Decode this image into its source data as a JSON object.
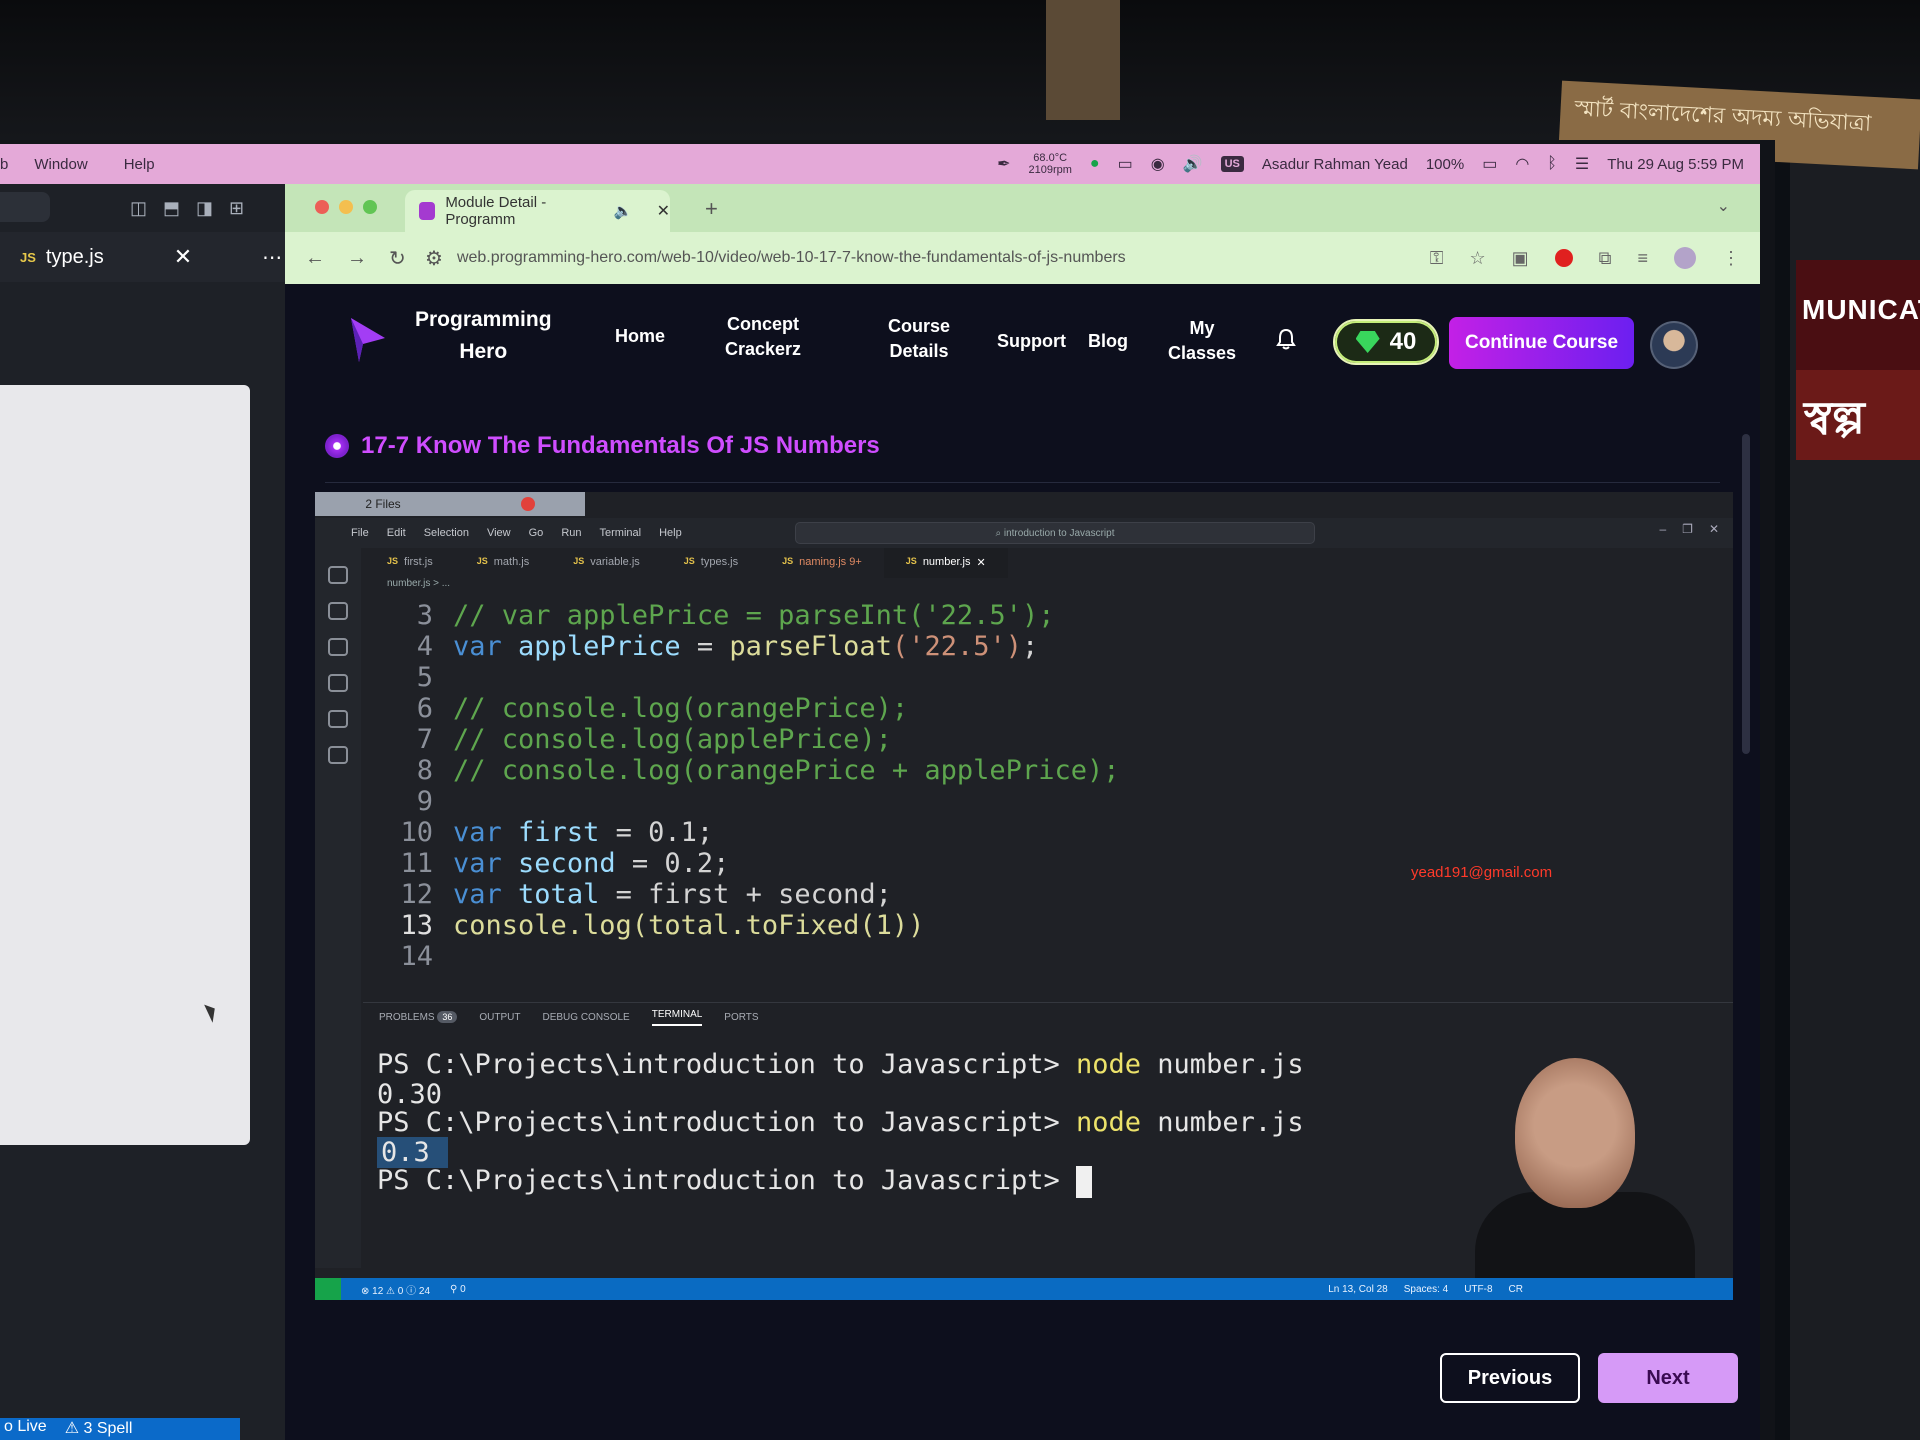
{
  "mac_menubar": {
    "items": [
      "b",
      "Window",
      "Help"
    ],
    "cpu_temp": "68.0°C",
    "fan_speed": "2109rpm",
    "input_source": "US",
    "user_name": "Asadur Rahman Yead",
    "battery": "100%",
    "datetime": "Thu 29 Aug  5:59 PM"
  },
  "left_editor": {
    "tab_label": "type.js",
    "tab_lang": "JS",
    "status_items": [
      "o Live",
      "⚠ 3 Spell"
    ]
  },
  "browser": {
    "tab_title": "Module Detail - Programm",
    "url": "web.programming-hero.com/web-10/video/web-10-17-7-know-the-fundamentals-of-js-numbers"
  },
  "site": {
    "brand_line1": "Programming",
    "brand_line2": "Hero",
    "nav": {
      "home": "Home",
      "concept_l1": "Concept",
      "concept_l2": "Crackerz",
      "course_l1": "Course",
      "course_l2": "Details",
      "support": "Support",
      "blog": "Blog",
      "classes_l1": "My",
      "classes_l2": "Classes"
    },
    "gems": "40",
    "continue_button": "Continue Course",
    "lesson_title": "17-7 Know The Fundamentals Of JS Numbers",
    "prev_button": "Previous",
    "next_button": "Next",
    "colors": {
      "accent": "#cf4dff",
      "button_gradient_start": "#c320e6",
      "button_gradient_end": "#6c1ff0"
    }
  },
  "video": {
    "files_window_title": "2 Files",
    "vscode_menu": [
      "File",
      "Edit",
      "Selection",
      "View",
      "Go",
      "Run",
      "Terminal",
      "Help"
    ],
    "vscode_search": "introduction to Javascript",
    "tabs": [
      "first.js",
      "math.js",
      "variable.js",
      "types.js",
      "naming.js 9+",
      "number.js"
    ],
    "breadcrumb": "number.js > ...",
    "email_watermark": "yead191@gmail.com",
    "code": {
      "l3": "// var applePrice = parseInt('22.5');",
      "l4_kw": "var",
      "l4_var": "applePrice",
      "l4_eq": " = ",
      "l4_fn": "parseFloat",
      "l4_str": "('22.5')",
      "l4_end": ";",
      "l6": "// console.log(orangePrice);",
      "l7": "// console.log(applePrice);",
      "l8": "// console.log(orangePrice + applePrice);",
      "l10_kw": "var",
      "l10_var": "first",
      "l10_rest": " = 0.1;",
      "l11_kw": "var",
      "l11_var": "second",
      "l11_rest": " = 0.2;",
      "l12_kw": "var",
      "l12_var": "total",
      "l12_rest": " = first + second;",
      "l13": "console.log(total.toFixed(1))"
    },
    "line_numbers": [
      "3",
      "4",
      "5",
      "6",
      "7",
      "8",
      "9",
      "10",
      "11",
      "12",
      "13",
      "14"
    ],
    "panel_tabs": [
      "PROBLEMS",
      "OUTPUT",
      "DEBUG CONSOLE",
      "TERMINAL",
      "PORTS"
    ],
    "problems_count": "36",
    "terminal": {
      "prompt": "PS C:\\Projects\\introduction to Javascript>",
      "cmd": "node",
      "arg": "number.js",
      "out1": "0.30",
      "out2": "0.3"
    },
    "status": {
      "errors": "⊗ 12 ⚠ 0 ⓘ 24",
      "ports": "⚲ 0",
      "position": "Ln 13, Col 28",
      "spaces": "Spaces: 4",
      "encoding": "UTF-8",
      "eol": "CR"
    }
  }
}
